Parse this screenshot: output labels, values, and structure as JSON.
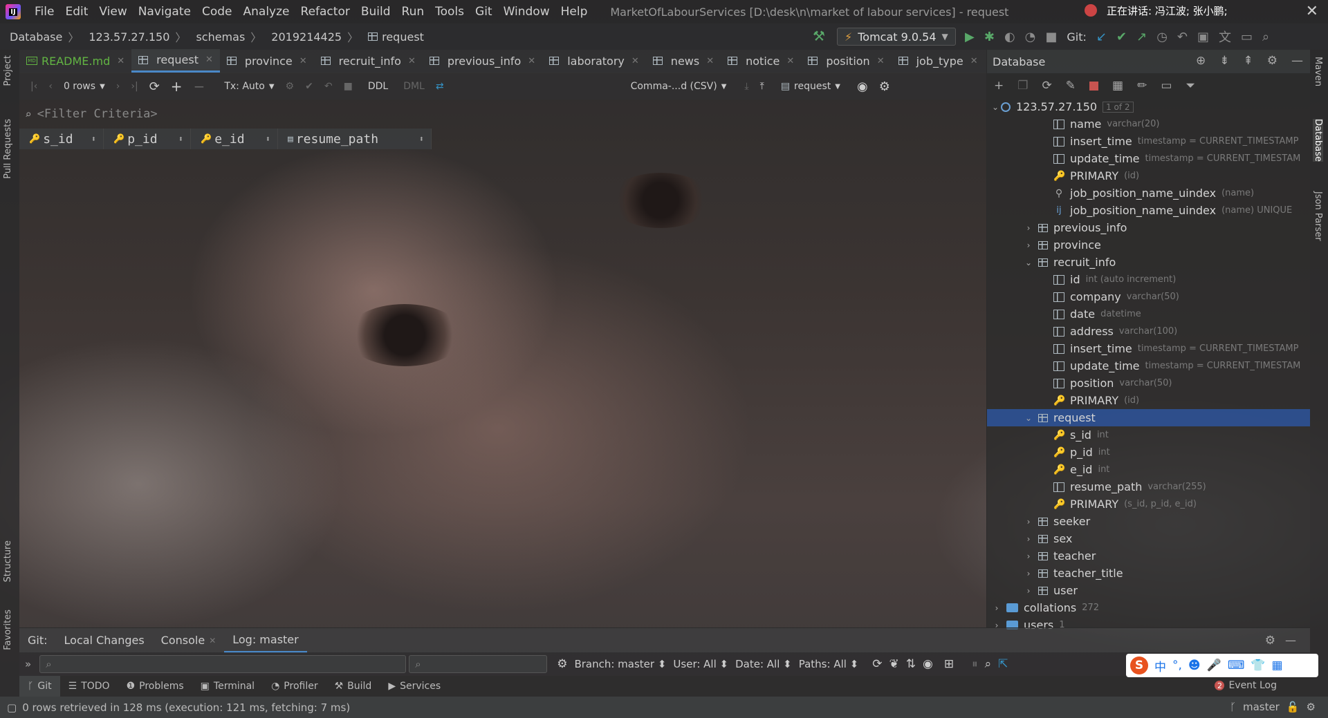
{
  "menubar": {
    "items": [
      "File",
      "Edit",
      "View",
      "Navigate",
      "Code",
      "Analyze",
      "Refactor",
      "Build",
      "Run",
      "Tools",
      "Git",
      "Window",
      "Help"
    ],
    "window_title": "MarketOfLabourServices [D:\\desk\\n\\market of labour services] - request",
    "talking": "正在讲话: 冯江波; 张小鹏;"
  },
  "breadcrumb": [
    "Database",
    "123.57.27.150",
    "schemas",
    "2019214425",
    "request"
  ],
  "run_config": "Tomcat 9.0.54",
  "git_label": "Git:",
  "editor_tabs": [
    {
      "label": "README.md"
    },
    {
      "label": "request"
    },
    {
      "label": "province"
    },
    {
      "label": "recruit_info"
    },
    {
      "label": "previous_info"
    },
    {
      "label": "laboratory"
    },
    {
      "label": "news"
    },
    {
      "label": "notice"
    },
    {
      "label": "position"
    },
    {
      "label": "job_type"
    }
  ],
  "table_toolbar": {
    "rows": "0 rows",
    "tx": "Tx: Auto",
    "ddl": "DDL",
    "dml": "DML",
    "export": "Comma-...d (CSV)",
    "table": "request"
  },
  "filter": {
    "placeholder": "<Filter Criteria>"
  },
  "grid": {
    "columns": [
      "s_id",
      "p_id",
      "e_id",
      "resume_path"
    ]
  },
  "db_panel": {
    "title": "Database",
    "server": "123.57.27.150",
    "server_badge": "1 of 2",
    "tree": [
      {
        "kind": "col",
        "label": "name",
        "type": "varchar(20)",
        "indent": 1
      },
      {
        "kind": "col",
        "label": "insert_time",
        "type": "timestamp = CURRENT_TIMESTAMP",
        "indent": 1
      },
      {
        "kind": "col",
        "label": "update_time",
        "type": "timestamp = CURRENT_TIMESTAM",
        "indent": 1
      },
      {
        "kind": "key",
        "label": "PRIMARY",
        "type": "(id)",
        "indent": 1
      },
      {
        "kind": "idx",
        "label": "job_position_name_uindex",
        "type": "(name)",
        "indent": 1
      },
      {
        "kind": "uq",
        "label": "job_position_name_uindex",
        "type": "(name) UNIQUE",
        "indent": 1
      },
      {
        "kind": "table",
        "label": "previous_info",
        "type": "",
        "indent": 0,
        "arrow": "›"
      },
      {
        "kind": "table",
        "label": "province",
        "type": "",
        "indent": 0,
        "arrow": "›"
      },
      {
        "kind": "table",
        "label": "recruit_info",
        "type": "",
        "indent": 0,
        "arrow": "⌄"
      },
      {
        "kind": "col",
        "label": "id",
        "type": "int (auto increment)",
        "indent": 1
      },
      {
        "kind": "col",
        "label": "company",
        "type": "varchar(50)",
        "indent": 1
      },
      {
        "kind": "col",
        "label": "date",
        "type": "datetime",
        "indent": 1
      },
      {
        "kind": "col",
        "label": "address",
        "type": "varchar(100)",
        "indent": 1
      },
      {
        "kind": "col",
        "label": "insert_time",
        "type": "timestamp = CURRENT_TIMESTAMP",
        "indent": 1
      },
      {
        "kind": "col",
        "label": "update_time",
        "type": "timestamp = CURRENT_TIMESTAM",
        "indent": 1
      },
      {
        "kind": "col",
        "label": "position",
        "type": "varchar(50)",
        "indent": 1
      },
      {
        "kind": "key",
        "label": "PRIMARY",
        "type": "(id)",
        "indent": 1
      },
      {
        "kind": "table",
        "label": "request",
        "type": "",
        "indent": 0,
        "arrow": "⌄",
        "selected": true
      },
      {
        "kind": "keycol",
        "label": "s_id",
        "type": "int",
        "indent": 1
      },
      {
        "kind": "keycol",
        "label": "p_id",
        "type": "int",
        "indent": 1
      },
      {
        "kind": "keycol",
        "label": "e_id",
        "type": "int",
        "indent": 1
      },
      {
        "kind": "col",
        "label": "resume_path",
        "type": "varchar(255)",
        "indent": 1
      },
      {
        "kind": "key",
        "label": "PRIMARY",
        "type": "(s_id, p_id, e_id)",
        "indent": 1
      },
      {
        "kind": "table",
        "label": "seeker",
        "type": "",
        "indent": 0,
        "arrow": "›"
      },
      {
        "kind": "table",
        "label": "sex",
        "type": "",
        "indent": 0,
        "arrow": "›"
      },
      {
        "kind": "table",
        "label": "teacher",
        "type": "",
        "indent": 0,
        "arrow": "›"
      },
      {
        "kind": "table",
        "label": "teacher_title",
        "type": "",
        "indent": 0,
        "arrow": "›"
      },
      {
        "kind": "table",
        "label": "user",
        "type": "",
        "indent": 0,
        "arrow": "›"
      },
      {
        "kind": "folder",
        "label": "collations",
        "type": "272",
        "indent": -1,
        "arrow": "›"
      },
      {
        "kind": "folder",
        "label": "users",
        "type": "1",
        "indent": -1,
        "arrow": "›"
      }
    ]
  },
  "left_strip": [
    "Project",
    "Pull Requests",
    "Structure",
    "Favorites"
  ],
  "right_strip": [
    "Maven",
    "Database",
    "Json Parser"
  ],
  "git_panel": {
    "label": "Git:",
    "tabs": [
      "Local Changes",
      "Console",
      "Log: master"
    ],
    "branch": "Branch: master",
    "user": "User: All",
    "date": "Date: All",
    "paths": "Paths: All"
  },
  "tool_windows": [
    "Git",
    "TODO",
    "Problems",
    "Terminal",
    "Profiler",
    "Build",
    "Services"
  ],
  "event_log": {
    "count": "2",
    "label": "Event Log"
  },
  "status": {
    "message": "0 rows retrieved in 128 ms (execution: 121 ms, fetching: 7 ms)",
    "branch": "master"
  },
  "ime": {
    "items": [
      "中",
      "°,",
      "☻",
      "🎤",
      "⌨",
      "👕",
      "▦"
    ]
  }
}
